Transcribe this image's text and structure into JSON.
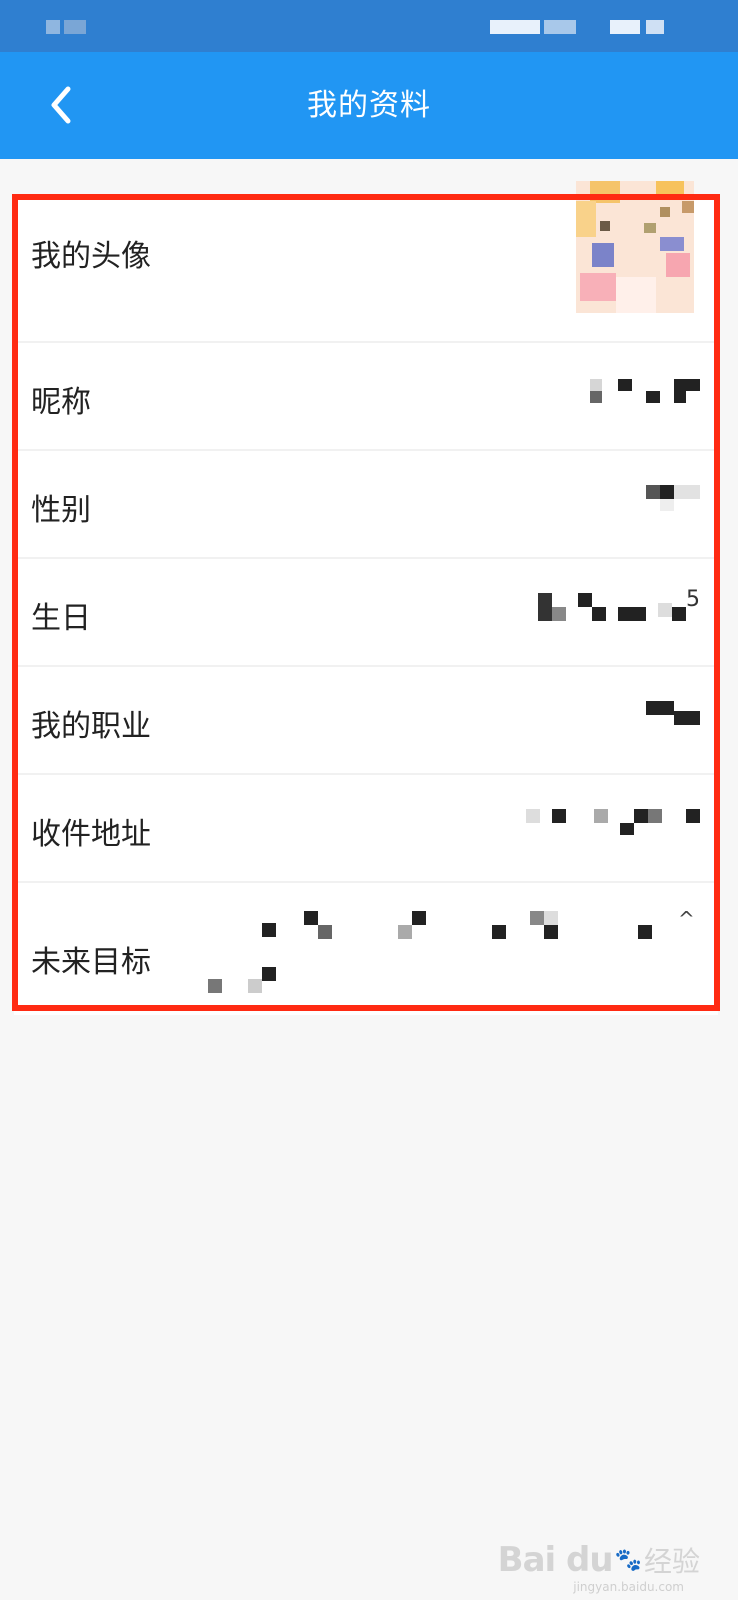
{
  "header": {
    "title": "我的资料",
    "background": "#2196f3"
  },
  "profile_rows": [
    {
      "label": "我的头像"
    },
    {
      "label": "昵称"
    },
    {
      "label": "性别"
    },
    {
      "label": "生日",
      "visible_fragment": "5"
    },
    {
      "label": "我的职业"
    },
    {
      "label": "收件地址"
    },
    {
      "label": "未来目标",
      "visible_fragment": "^"
    }
  ],
  "highlight_color": "#ff2a12",
  "watermark": {
    "brand": "Bai du",
    "product": "经验",
    "url": "jingyan.baidu.com"
  },
  "icons": {
    "back": "chevron-left-icon",
    "avatar": "avatar-image"
  }
}
